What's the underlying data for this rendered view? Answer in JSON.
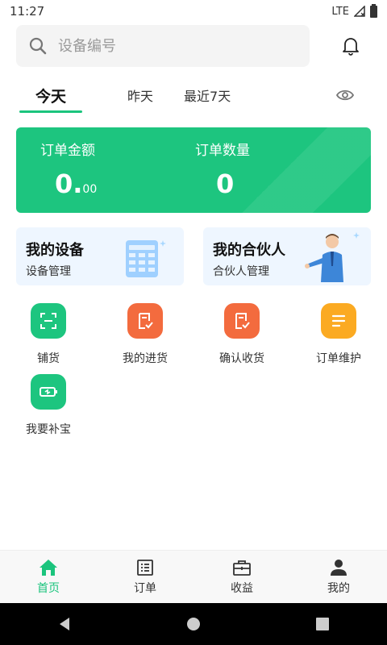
{
  "status_bar": {
    "time": "11:27",
    "network": "LTE"
  },
  "search": {
    "placeholder": "设备编号"
  },
  "tabs": [
    {
      "label": "今天",
      "active": true
    },
    {
      "label": "昨天",
      "active": false
    },
    {
      "label": "最近7天",
      "active": false
    }
  ],
  "stats": {
    "amount_label": "订单金额",
    "amount_int": "0.",
    "amount_dec": "00",
    "count_label": "订单数量",
    "count_value": "0"
  },
  "cards": [
    {
      "title": "我的设备",
      "subtitle": "设备管理"
    },
    {
      "title": "我的合伙人",
      "subtitle": "合伙人管理"
    }
  ],
  "grid_items": [
    {
      "label": "铺货",
      "icon": "scan-icon",
      "color": "#1dc57f"
    },
    {
      "label": "我的进货",
      "icon": "receipt-check-icon",
      "color": "#f36b3e"
    },
    {
      "label": "确认收货",
      "icon": "receipt-check-icon",
      "color": "#f36b3e"
    },
    {
      "label": "订单维护",
      "icon": "list-icon",
      "color": "#fbaa22"
    },
    {
      "label": "我要补宝",
      "icon": "battery-icon",
      "color": "#1dc57f"
    }
  ],
  "bottom_nav": [
    {
      "label": "首页",
      "icon": "home-icon",
      "active": true
    },
    {
      "label": "订单",
      "icon": "order-list-icon",
      "active": false
    },
    {
      "label": "收益",
      "icon": "briefcase-icon",
      "active": false
    },
    {
      "label": "我的",
      "icon": "user-icon",
      "active": false
    }
  ],
  "colors": {
    "accent": "#1bc47d",
    "card_bg": "#eef6ff",
    "orange": "#f36b3e",
    "yellow": "#fbaa22"
  }
}
